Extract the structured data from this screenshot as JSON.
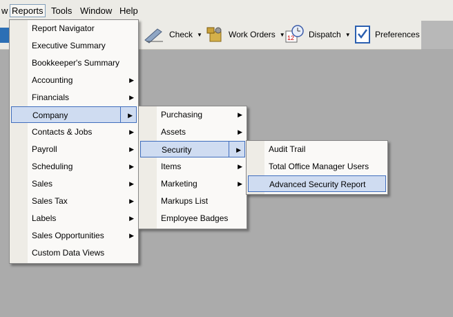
{
  "menubar": {
    "items": [
      {
        "label": "w"
      },
      {
        "label": "Reports"
      },
      {
        "label": "Tools"
      },
      {
        "label": "Window"
      },
      {
        "label": "Help"
      }
    ]
  },
  "toolbar": {
    "check_label": "Check",
    "workorders_label": "Work Orders",
    "dispatch_label": "Dispatch",
    "preferences_label": "Preferences",
    "dispatch_icon_date": "12"
  },
  "reports_menu": {
    "items": [
      {
        "label": "Report Navigator",
        "submenu": false
      },
      {
        "label": "Executive Summary",
        "submenu": false
      },
      {
        "label": "Bookkeeper's Summary",
        "submenu": false
      },
      {
        "label": "Accounting",
        "submenu": true
      },
      {
        "label": "Financials",
        "submenu": true
      },
      {
        "label": "Company",
        "submenu": true
      },
      {
        "label": "Contacts & Jobs",
        "submenu": true
      },
      {
        "label": "Payroll",
        "submenu": true
      },
      {
        "label": "Scheduling",
        "submenu": true
      },
      {
        "label": "Sales",
        "submenu": true
      },
      {
        "label": "Sales Tax",
        "submenu": true
      },
      {
        "label": "Labels",
        "submenu": true
      },
      {
        "label": "Sales Opportunities",
        "submenu": true
      },
      {
        "label": "Custom Data Views",
        "submenu": false
      }
    ]
  },
  "company_menu": {
    "items": [
      {
        "label": "Purchasing",
        "submenu": true
      },
      {
        "label": "Assets",
        "submenu": true
      },
      {
        "label": "Security",
        "submenu": true
      },
      {
        "label": "Items",
        "submenu": true
      },
      {
        "label": "Marketing",
        "submenu": true
      },
      {
        "label": "Markups List",
        "submenu": false
      },
      {
        "label": "Employee Badges",
        "submenu": false
      }
    ]
  },
  "security_menu": {
    "items": [
      {
        "label": "Audit Trail"
      },
      {
        "label": "Total Office Manager Users"
      },
      {
        "label": "Advanced Security Report"
      }
    ]
  },
  "arrow_glyph": "▶",
  "dropdown_glyph": "▼"
}
